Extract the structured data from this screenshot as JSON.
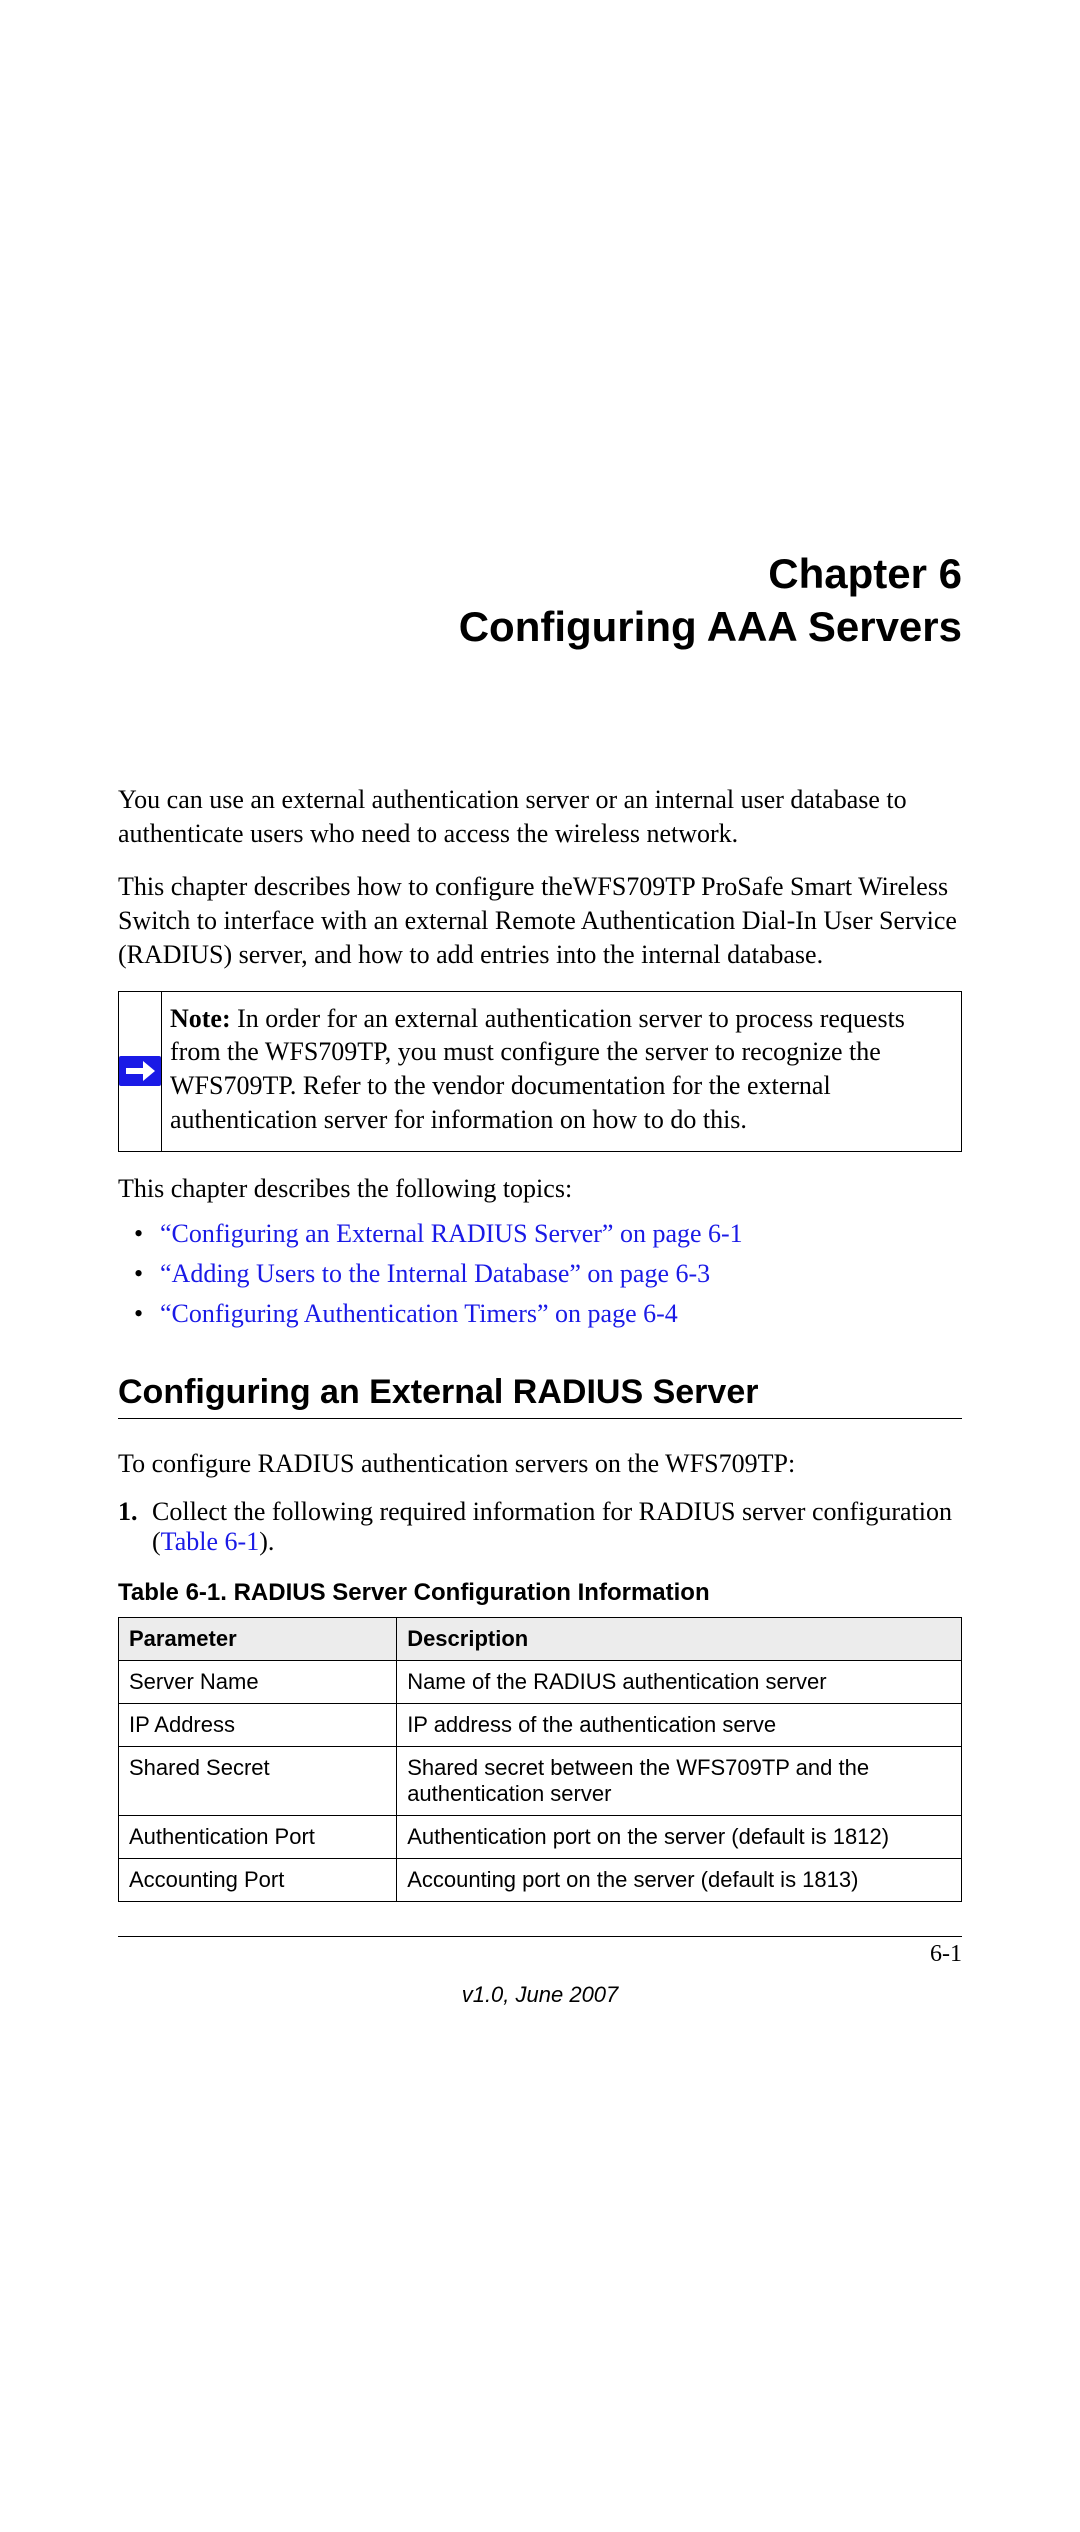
{
  "chapter": {
    "line1": "Chapter 6",
    "line2": "Configuring AAA Servers"
  },
  "paragraphs": {
    "p1": "You can use an external authentication server or an internal user database to authenticate users who need to access the wireless network.",
    "p2": "This chapter describes how to configure theWFS709TP ProSafe Smart Wireless Switch to interface with an external Remote Authentication Dial-In User Service (RADIUS) server, and how to add entries into the internal database."
  },
  "note": {
    "label": "Note:",
    "text": " In order for an external authentication server to process requests from the WFS709TP, you must configure the server to recognize the WFS709TP. Refer to the vendor documentation for the external authentication server for information on how to do this."
  },
  "topics_intro": "This chapter describes the following topics:",
  "topics": [
    "“Configuring an External RADIUS Server” on page 6-1",
    "“Adding Users to the Internal Database” on page 6-3",
    "“Configuring Authentication Timers” on page 6-4"
  ],
  "section_heading": "Configuring an External RADIUS Server",
  "step_intro": "To configure RADIUS authentication servers on the WFS709TP:",
  "step1": {
    "num": "1.",
    "text_before_link": "Collect the following required information for RADIUS server configuration (",
    "link": "Table 6-1",
    "text_after_link": ")."
  },
  "table": {
    "caption": "Table 6-1.   RADIUS Server Configuration Information",
    "headers": [
      "Parameter",
      "Description"
    ],
    "rows": [
      [
        "Server Name",
        "Name of the RADIUS authentication server"
      ],
      [
        "IP Address",
        "IP address of the authentication serve"
      ],
      [
        "Shared Secret",
        "Shared secret between the WFS709TP and the authentication server"
      ],
      [
        "Authentication Port",
        "Authentication port on the server (default is 1812)"
      ],
      [
        "Accounting Port",
        "Accounting port on the server (default is 1813)"
      ]
    ]
  },
  "footer": {
    "page_number": "6-1",
    "version": "v1.0, June 2007"
  }
}
